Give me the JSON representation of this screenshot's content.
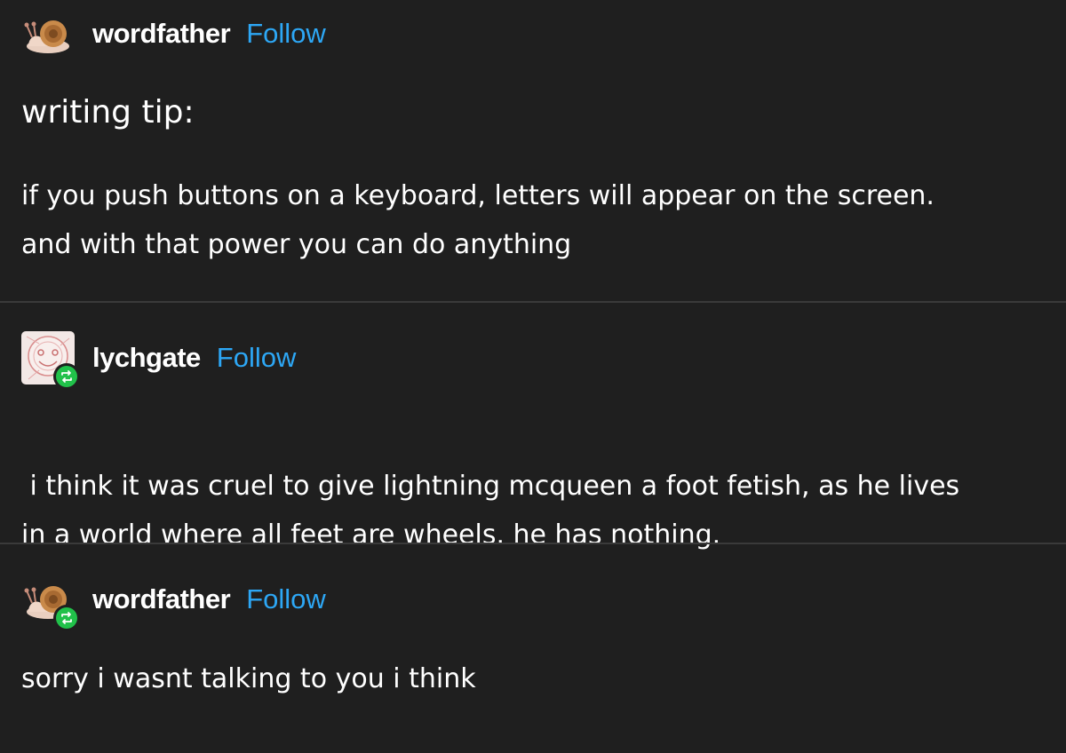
{
  "posts": [
    {
      "username": "wordfather",
      "follow_label": "Follow",
      "avatar_icon": "snail-icon",
      "reblogged": false,
      "heading": "writing tip:",
      "lines": [
        "if you push buttons on a keyboard, letters will appear on the screen.",
        "and with that power you can do anything"
      ]
    },
    {
      "username": "lychgate",
      "follow_label": "Follow",
      "avatar_icon": "face-sketch-icon",
      "reblogged": true,
      "lines": [
        " i think it was cruel to give lightning mcqueen a foot fetish, as he lives",
        "in a world where all feet are wheels. he has nothing."
      ]
    },
    {
      "username": "wordfather",
      "follow_label": "Follow",
      "avatar_icon": "snail-icon",
      "reblogged": true,
      "lines": [
        "sorry i wasnt talking to you i think"
      ]
    }
  ],
  "colors": {
    "background": "#1f1f1f",
    "text": "#ffffff",
    "follow": "#2da7f5",
    "reblog_badge": "#21c14a",
    "divider": "#3a3a3a"
  }
}
